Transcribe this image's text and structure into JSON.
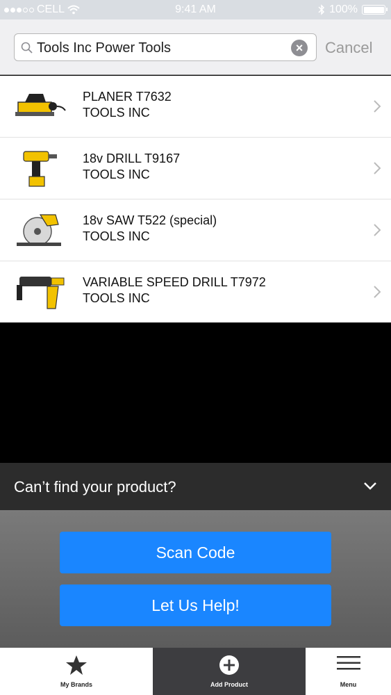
{
  "status_bar": {
    "carrier": "CELL",
    "time": "9:41 AM",
    "battery": "100%"
  },
  "search": {
    "query": "Tools Inc Power Tools",
    "cancel_label": "Cancel"
  },
  "products": [
    {
      "name": "PLANER T7632",
      "brand": "TOOLS INC",
      "icon": "planer"
    },
    {
      "name": "18v DRILL T9167",
      "brand": "TOOLS INC",
      "icon": "cordless-drill"
    },
    {
      "name": "18v SAW T522 (special)",
      "brand": "TOOLS INC",
      "icon": "circular-saw"
    },
    {
      "name": "VARIABLE SPEED DRILL T7972",
      "brand": "TOOLS INC",
      "icon": "hammer-drill"
    }
  ],
  "cant_find": {
    "label": "Can’t find your product?"
  },
  "actions": {
    "scan_label": "Scan Code",
    "help_label": "Let Us Help!"
  },
  "tabbar": {
    "brands_label": "My Brands",
    "add_label": "Add Product",
    "menu_label": "Menu"
  },
  "colors": {
    "accent": "#1a86ff",
    "tool_yellow": "#f2c200"
  }
}
